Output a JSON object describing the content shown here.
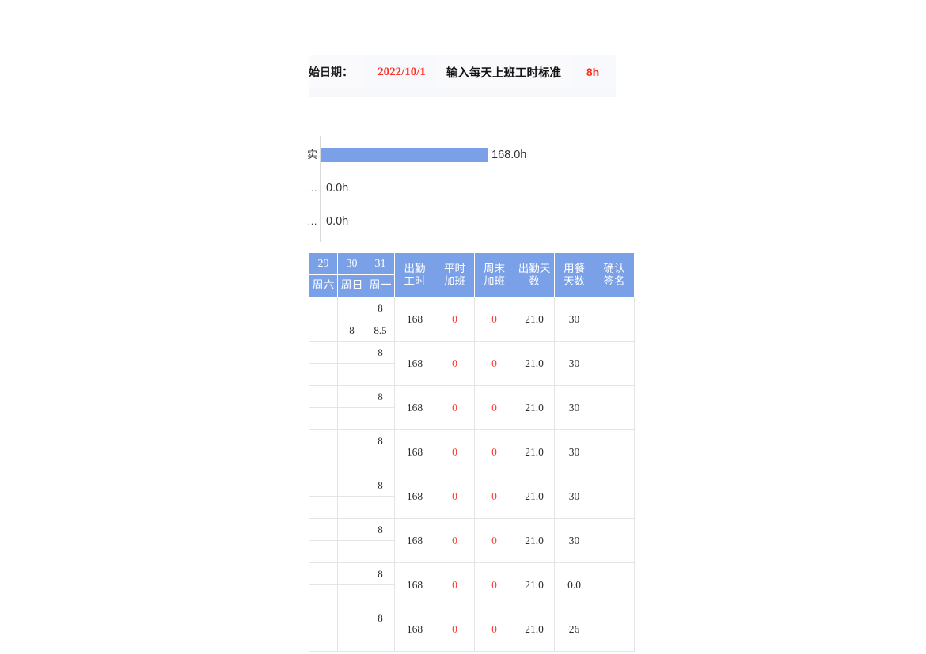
{
  "header": {
    "date_label": "始日期：",
    "date_value": "2022/10/1",
    "standard_label": "输入每天上班工时标准",
    "standard_value": "8h"
  },
  "chart_data": {
    "type": "bar",
    "orientation": "horizontal",
    "categories": [
      "实",
      "…",
      "…"
    ],
    "values": [
      168.0,
      0.0,
      0.0
    ],
    "value_labels": [
      "168.0h",
      "0.0h",
      "0.0h"
    ],
    "title": "",
    "xlabel": "",
    "ylabel": "",
    "xlim": [
      0,
      168
    ],
    "grid": false,
    "legend": false,
    "bar_color": "#7aa0e8"
  },
  "table": {
    "header_top": [
      "29",
      "30",
      "31"
    ],
    "header_bottom": [
      "周六",
      "周日",
      "周一"
    ],
    "header_merged": [
      {
        "line1": "出勤",
        "line2": "工时"
      },
      {
        "line1": "平时",
        "line2": "加班"
      },
      {
        "line1": "周末",
        "line2": "加班"
      },
      {
        "line1": "出勤天",
        "line2": "数"
      },
      {
        "line1": "用餐",
        "line2": "天数"
      },
      {
        "line1": "确认",
        "line2": "签名"
      }
    ],
    "rows": [
      {
        "d29_a": "",
        "d30_a": "",
        "d31_a": "8",
        "d29_b": "",
        "d30_b": "8",
        "d31_b": "8.5",
        "work_hours": "168",
        "weekday_ot": "0",
        "weekend_ot": "0",
        "attend_days": "21.0",
        "meal_days": "30",
        "signature": ""
      },
      {
        "d29_a": "",
        "d30_a": "",
        "d31_a": "8",
        "d29_b": "",
        "d30_b": "",
        "d31_b": "",
        "work_hours": "168",
        "weekday_ot": "0",
        "weekend_ot": "0",
        "attend_days": "21.0",
        "meal_days": "30",
        "signature": ""
      },
      {
        "d29_a": "",
        "d30_a": "",
        "d31_a": "8",
        "d29_b": "",
        "d30_b": "",
        "d31_b": "",
        "work_hours": "168",
        "weekday_ot": "0",
        "weekend_ot": "0",
        "attend_days": "21.0",
        "meal_days": "30",
        "signature": ""
      },
      {
        "d29_a": "",
        "d30_a": "",
        "d31_a": "8",
        "d29_b": "",
        "d30_b": "",
        "d31_b": "",
        "work_hours": "168",
        "weekday_ot": "0",
        "weekend_ot": "0",
        "attend_days": "21.0",
        "meal_days": "30",
        "signature": ""
      },
      {
        "d29_a": "",
        "d30_a": "",
        "d31_a": "8",
        "d29_b": "",
        "d30_b": "",
        "d31_b": "",
        "work_hours": "168",
        "weekday_ot": "0",
        "weekend_ot": "0",
        "attend_days": "21.0",
        "meal_days": "30",
        "signature": ""
      },
      {
        "d29_a": "",
        "d30_a": "",
        "d31_a": "8",
        "d29_b": "",
        "d30_b": "",
        "d31_b": "",
        "work_hours": "168",
        "weekday_ot": "0",
        "weekend_ot": "0",
        "attend_days": "21.0",
        "meal_days": "30",
        "signature": ""
      },
      {
        "d29_a": "",
        "d30_a": "",
        "d31_a": "8",
        "d29_b": "",
        "d30_b": "",
        "d31_b": "",
        "work_hours": "168",
        "weekday_ot": "0",
        "weekend_ot": "0",
        "attend_days": "21.0",
        "meal_days": "0.0",
        "signature": ""
      },
      {
        "d29_a": "",
        "d30_a": "",
        "d31_a": "8",
        "d29_b": "",
        "d30_b": "",
        "d31_b": "",
        "work_hours": "168",
        "weekday_ot": "0",
        "weekend_ot": "0",
        "attend_days": "21.0",
        "meal_days": "26",
        "signature": ""
      }
    ]
  }
}
